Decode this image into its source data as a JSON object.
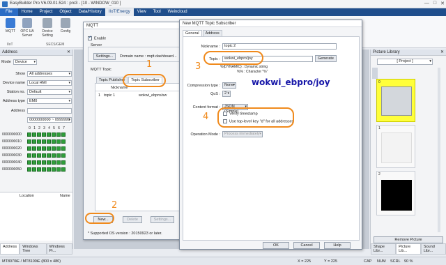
{
  "window": {
    "title": "EasyBuilder Pro V6.09.01.524 : pro3 - [10 - WINDOW_010 ]",
    "controls": [
      "—",
      "□",
      "✕"
    ]
  },
  "menu": {
    "file": "File",
    "items": [
      "Home",
      "Project",
      "Object",
      "Data/History",
      "IIoT/Energy",
      "View",
      "Tool",
      "Weincloud"
    ],
    "active_index": 4
  },
  "ribbon": {
    "buttons": [
      "MQTT",
      "OPC UA Server",
      "Device Setting",
      "Config"
    ],
    "groups": [
      "IIoT",
      "SECS/GEM"
    ]
  },
  "address_panel": {
    "title": "Address",
    "fields": [
      {
        "label": "Mode",
        "value": "Device"
      },
      {
        "label": "Show",
        "value": "All addresses"
      },
      {
        "label": "Device name",
        "value": "Local HMI"
      },
      {
        "label": "Station no.",
        "value": "Default"
      },
      {
        "label": "Address type",
        "value": "EM0"
      },
      {
        "label": "Address",
        "value": ""
      }
    ],
    "range": "0000000000 ~ 0999999",
    "bit_headers": [
      "0",
      "1",
      "2",
      "3",
      "4",
      "5",
      "6",
      "7"
    ],
    "rows": [
      "0000000000",
      "0000000010",
      "0000000020",
      "0000000030",
      "0000000040",
      "0000000050"
    ],
    "table_headers": [
      "Location",
      "Name"
    ],
    "bottom_tabs": [
      "Address",
      "Windows Tree",
      "Windows Pr..."
    ]
  },
  "mqtt_dialog": {
    "title": "MQTT",
    "enable_label": "Enable",
    "server_label": "Server",
    "settings_button": "Settings...",
    "domain_text": "Domain name : mqtt.dashboard...",
    "mqtt_topic_label": "MQTT Topic",
    "tabs": [
      "Topic Publisher",
      "Topic Subscriber"
    ],
    "table_header": "Nickname",
    "rows": [
      {
        "index": "1",
        "nickname": "topic 1",
        "topic": "wokwi_ebpro/sw"
      }
    ],
    "buttons": [
      "New...",
      "Delete",
      "Settings..."
    ],
    "footnote": "* Supported OS version : 20150923 or later."
  },
  "subscriber_dialog": {
    "title": "New MQTT Topic Subscriber",
    "tabs": [
      "General",
      "Address"
    ],
    "nickname_label": "Nickname :",
    "nickname_value": "topic 2",
    "topic_label": "Topic :",
    "topic_value": "wokwi_ebpro/joy",
    "generate_button": "Generate",
    "hint1": "%{DYNAMIC} : Dynamic string",
    "hint2": "%% : Character \"%\"",
    "compression_label": "Compression type :",
    "compression_value": "None",
    "qos_label": "QoS :",
    "qos_value": "2",
    "content_label": "Content format :",
    "content_value": "JSON (Simple)",
    "verify_label": "Verify timestamp",
    "toplevel_label": "Use top-level key \"d\" for all addresses",
    "opmode_label": "Operation Mode :",
    "opmode_value": "Process immediately",
    "ok": "OK",
    "cancel": "Cancel",
    "help": "Help"
  },
  "annotations": {
    "n1": "1",
    "n2": "2",
    "n3": "3",
    "n4": "4",
    "big": "wokwi_ebpro/joy"
  },
  "picture_library": {
    "title": "Picture Library",
    "project_label": "[ Project ]",
    "items": [
      "0",
      "1",
      "2"
    ],
    "remove_button": "Remove Picture",
    "tabs": [
      "Shape Libr...",
      "Picture Lib...",
      "Sound Libr..."
    ]
  },
  "status_bar": {
    "model": "MT8070iE / MT8100iE (800 x 480)",
    "x": "X = 225",
    "y": "Y = 225",
    "caps": "CAP",
    "num": "NUM",
    "scrl": "SCRL",
    "zoom": "90 %"
  },
  "colors": {
    "accent": "#1f4e8c",
    "annotation": "#f08a1c",
    "callout_text": "#1616a8",
    "bit_on": "#2f9e3a"
  }
}
